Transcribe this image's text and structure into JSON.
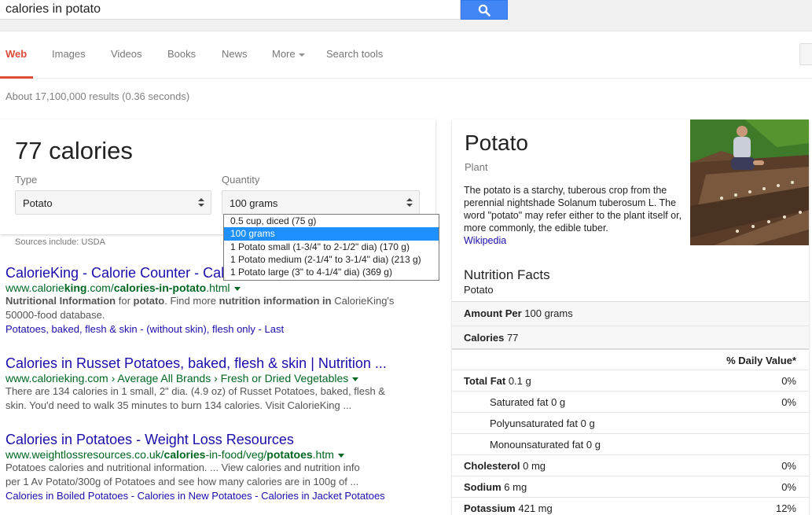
{
  "search": {
    "query": "calories in potato"
  },
  "nav": {
    "web": "Web",
    "images": "Images",
    "videos": "Videos",
    "books": "Books",
    "news": "News",
    "more": "More",
    "search_tools": "Search tools"
  },
  "stats": "About 17,100,000 results (0.36 seconds)",
  "calorie_card": {
    "value": "77 calories",
    "type_label": "Type",
    "type_value": "Potato",
    "quantity_label": "Quantity",
    "quantity_value": "100 grams",
    "options": [
      "0.5 cup, diced (75 g)",
      "100 grams",
      "1 Potato small (1-3/4\" to 2-1/2\" dia) (170 g)",
      "1 Potato medium (2-1/4\" to 3-1/4\" dia) (213 g)",
      "1 Potato large (3\" to 4-1/4\" dia) (369 g)"
    ],
    "sources": "Sources include: USDA"
  },
  "results": [
    {
      "title": "CalorieKing - Calorie Counter - Calories in Potato",
      "url_pre": "www.calorie",
      "url_b1": "king",
      "url_mid": ".com/",
      "url_b2": "calories-in-potato",
      "url_post": ".html",
      "snip1_b": "Nutritional Information",
      "snip1_a": " for ",
      "snip1_b2": "potato",
      "snip1_c": ". Find more ",
      "snip1_b3": "nutrition",
      "snip1_d": " ",
      "snip1_b4": "information in",
      "snip1_e": " CalorieKing's",
      "snip2": "50000-food database.",
      "links": "Potatoes, baked, flesh & skin - (without skin), flesh only - Last"
    },
    {
      "title": "Calories in Russet Potatoes, baked, flesh & skin | Nutrition ...",
      "url": "www.calorieking.com › Average All Brands › Fresh or Dried Vegetables",
      "snip_line1": "There are 134 calories in 1 small, 2\" dia. (4.9 oz) of Russet Potatoes, baked, flesh &",
      "snip_line2": "skin. You'd need to walk 35 minutes to burn 134 calories. Visit CalorieKing ..."
    },
    {
      "title": "Calories in Potatoes - Weight Loss Resources",
      "url_pre": "www.weightlossresources.co.uk/",
      "url_b1": "calories",
      "url_mid": "-in-food/veg/",
      "url_b2": "potatoes",
      "url_post": ".htm",
      "snip_line1": "Potatoes calories and nutritional information. ... View calories and nutrition info",
      "snip_line2": "per 1 Av Potato/300g of Potatoes and see how many calories are in 100g of ...",
      "links": "Calories in Boiled Potatoes - Calories in New Potatoes - Calories in Jacket Potatoes"
    }
  ],
  "knowledge": {
    "title": "Potato",
    "subtitle": "Plant",
    "desc": "The potato is a starchy, tuberous crop from the perennial nightshade Solanum tuberosum L. The word \"potato\" may refer either to the plant itself or, more commonly, the edible tuber.",
    "source": "Wikipedia",
    "nutrition_title": "Nutrition Facts",
    "nutrition_sub": "Potato",
    "amount_label": "Amount Per",
    "amount_value": "100 grams",
    "calories_label": "Calories",
    "calories_value": "77",
    "dv_header": "% Daily Value*",
    "rows": [
      {
        "label": "Total Fat",
        "value": "0.1 g",
        "pct": "0%",
        "bold": true,
        "indent": false
      },
      {
        "label": "Saturated fat",
        "value": "0 g",
        "pct": "0%",
        "bold": false,
        "indent": true
      },
      {
        "label": "Polyunsaturated fat",
        "value": "0 g",
        "pct": "",
        "bold": false,
        "indent": true
      },
      {
        "label": "Monounsaturated fat",
        "value": "0 g",
        "pct": "",
        "bold": false,
        "indent": true
      },
      {
        "label": "Cholesterol",
        "value": "0 mg",
        "pct": "0%",
        "bold": true,
        "indent": false
      },
      {
        "label": "Sodium",
        "value": "6 mg",
        "pct": "0%",
        "bold": true,
        "indent": false
      },
      {
        "label": "Potassium",
        "value": "421 mg",
        "pct": "12%",
        "bold": true,
        "indent": false
      }
    ]
  },
  "colors": {
    "accent_red": "#dd4b39",
    "link_blue": "#1a0dab",
    "url_green": "#006621",
    "search_blue": "#4285f4"
  }
}
